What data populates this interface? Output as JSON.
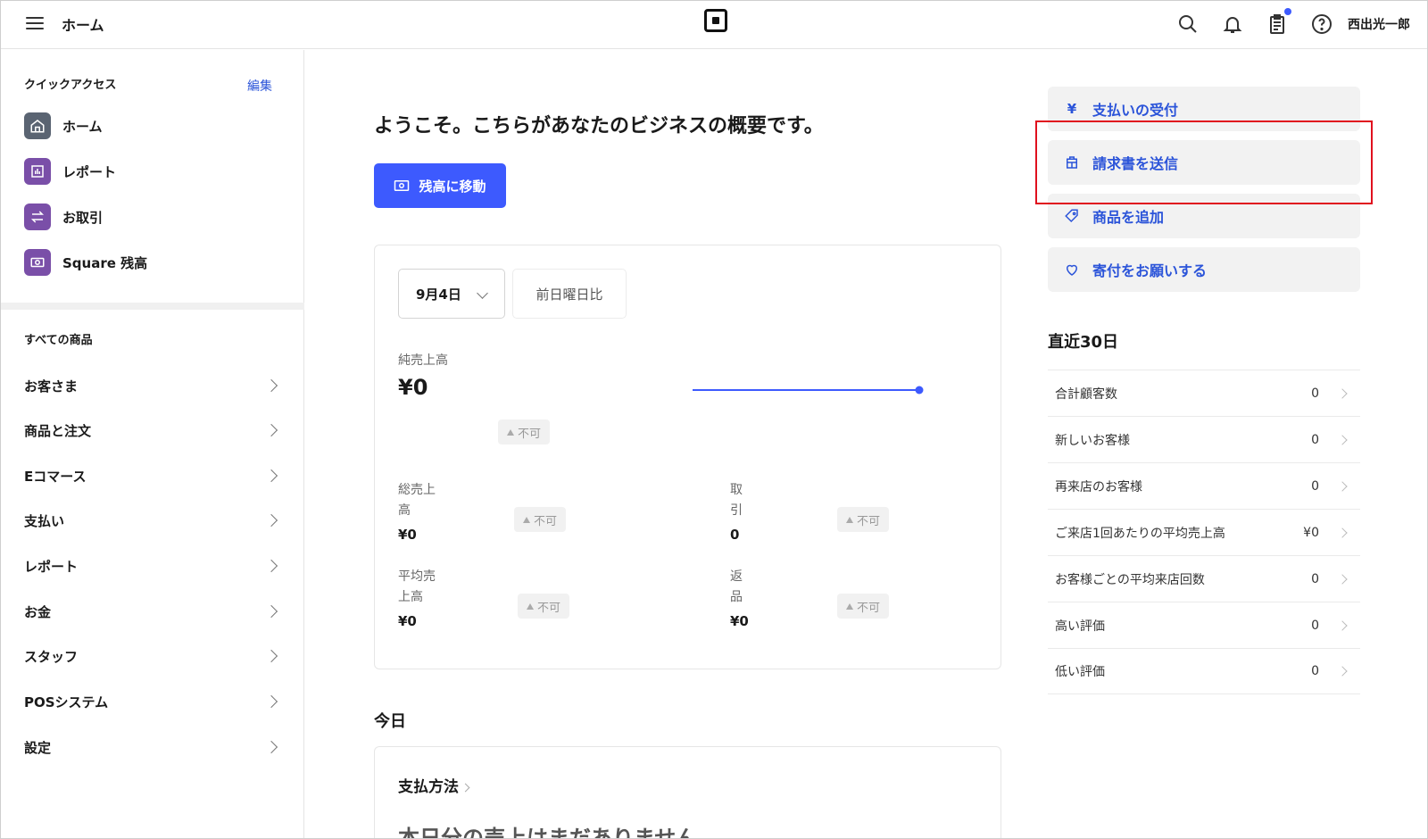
{
  "topbar": {
    "title": "ホーム",
    "user_name": "西出光一郎",
    "icons": [
      "menu-icon",
      "square-logo-icon",
      "search-icon",
      "bell-icon",
      "clipboard-icon",
      "help-icon"
    ]
  },
  "sidebar": {
    "quick_access_heading": "クイックアクセス",
    "edit_label": "編集",
    "quick_items": [
      {
        "label": "ホーム",
        "icon": "home-icon",
        "color": "#5a6472"
      },
      {
        "label": "レポート",
        "icon": "bar-chart-icon",
        "color": "#7a4fa8"
      },
      {
        "label": "お取引",
        "icon": "swap-arrows-icon",
        "color": "#7a4fa8"
      },
      {
        "label": "Square 残高",
        "icon": "cash-icon",
        "color": "#7a4fa8"
      }
    ],
    "all_items_heading": "すべての商品",
    "nav_items": [
      "お客さま",
      "商品と注文",
      "Eコマース",
      "支払い",
      "レポート",
      "お金",
      "スタッフ",
      "POSシステム",
      "設定"
    ]
  },
  "main": {
    "welcome": "ようこそ。こちらがあなたのビジネスの概要です。",
    "balance_button": "残高に移動",
    "date_selected": "9月4日",
    "compare_label": "前日曜日比",
    "net_sales_label": "純売上高",
    "net_sales_value": "¥0",
    "not_available": "不可",
    "gross_sales_label_1": "総売上",
    "gross_sales_label_2": "高",
    "gross_sales_value": "¥0",
    "transactions_label_1": "取",
    "transactions_label_2": "引",
    "transactions_value": "0",
    "avg_sales_label_1": "平均売",
    "avg_sales_label_2": "上高",
    "avg_sales_value": "¥0",
    "returns_label_1": "返",
    "returns_label_2": "品",
    "returns_value": "¥0",
    "today_heading": "今日",
    "payment_method": "支払方法",
    "no_sales": "本日分の売上はまだありません"
  },
  "actions": [
    {
      "label": "支払いの受付",
      "icon": "yen-icon"
    },
    {
      "label": "請求書を送信",
      "icon": "invoice-icon"
    },
    {
      "label": "商品を追加",
      "icon": "tag-icon"
    },
    {
      "label": "寄付をお願いする",
      "icon": "heart-icon"
    }
  ],
  "recent": {
    "heading": "直近30日",
    "rows": [
      {
        "label": "合計顧客数",
        "value": "0"
      },
      {
        "label": "新しいお客様",
        "value": "0"
      },
      {
        "label": "再来店のお客様",
        "value": "0"
      },
      {
        "label": "ご来店1回あたりの平均売上高",
        "value": "¥0"
      },
      {
        "label": "お客様ごとの平均来店回数",
        "value": "0"
      },
      {
        "label": "高い評価",
        "value": "0"
      },
      {
        "label": "低い評価",
        "value": "0"
      }
    ]
  },
  "colors": {
    "accent": "#3d5afe",
    "link": "#2b54d9",
    "highlight_box": "#e0101e"
  }
}
